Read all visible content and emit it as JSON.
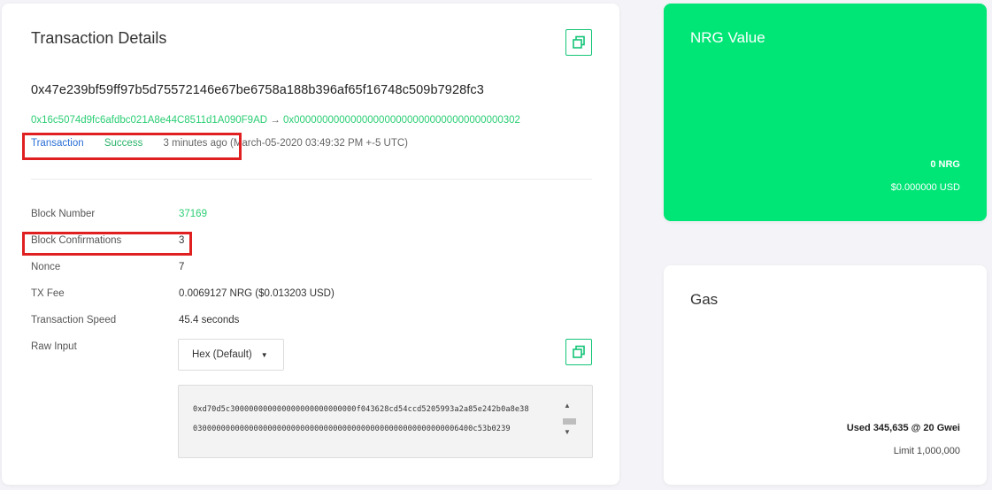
{
  "details": {
    "title": "Transaction Details",
    "hash": "0x47e239bf59ff97b5d75572146e67be6758a188b396af65f16748c509b7928fc3",
    "from": "0x16c5074d9fc6afdbc021A8e44C8511d1A090F9AD",
    "arrow": "→",
    "to": "0x0000000000000000000000000000000000000302",
    "type": "Transaction",
    "status": "Success",
    "age": "3 minutes ago",
    "date": "(March-05-2020 03:49:32 PM +-5 UTC)"
  },
  "rows": [
    {
      "label": "Block Number",
      "value": "37169"
    },
    {
      "label": "Block Confirmations",
      "value": "3"
    },
    {
      "label": "Nonce",
      "value": "7"
    },
    {
      "label": "TX Fee",
      "value": "0.0069127 NRG ($0.013203 USD)"
    },
    {
      "label": "Transaction Speed",
      "value": "45.4 seconds"
    },
    {
      "label": "Raw Input",
      "value": ""
    }
  ],
  "raw_input": {
    "format_selected": "Hex (Default)",
    "line1": "0xd70d5c300000000000000000000000000f043628cd54ccd5205993a2a85e242b0a8e38",
    "line2": "030000000000000000000000000000000000000000000000000000006400c53b0239"
  },
  "nrg_value": {
    "title": "NRG Value",
    "amount": "0 NRG",
    "usd": "$0.000000 USD"
  },
  "gas": {
    "title": "Gas",
    "used": "Used 345,635 @ 20 Gwei",
    "limit": "Limit 1,000,000"
  },
  "colors": {
    "accent_green": "#00e676",
    "link_green": "#2bce74",
    "link_blue": "#2a6fd6",
    "highlight_red": "#e02020"
  }
}
